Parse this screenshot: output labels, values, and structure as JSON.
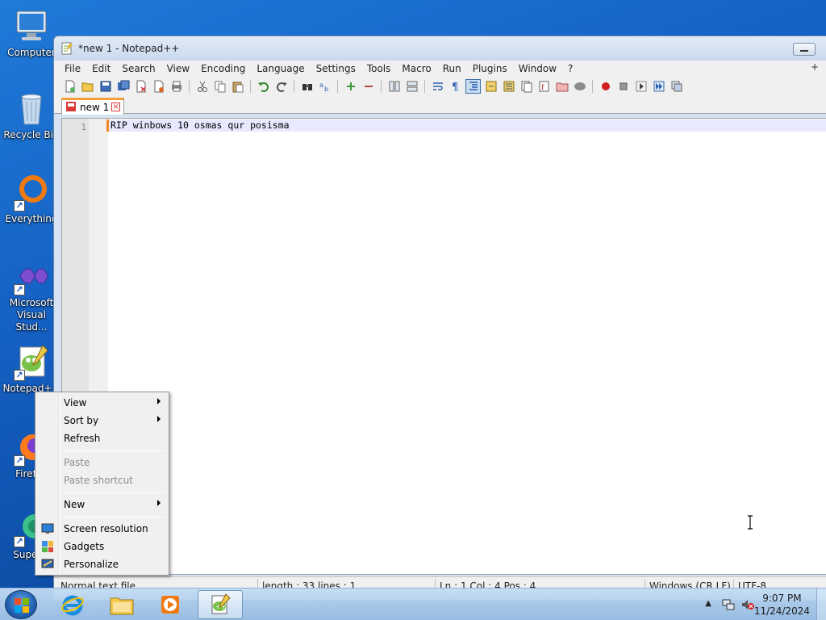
{
  "desktop": {
    "icons": [
      {
        "label": "Computer",
        "icon": "computer-icon"
      },
      {
        "label": "Recycle Bin",
        "icon": "recycle-bin-icon"
      },
      {
        "label": "Everything",
        "icon": "everything-icon"
      },
      {
        "label": "Microsoft Visual Stud...",
        "icon": "visual-studio-icon"
      },
      {
        "label": "Notepad++",
        "icon": "notepad-plus-plus-icon"
      },
      {
        "label": "Firefox",
        "icon": "firefox-icon"
      },
      {
        "label": "Super...",
        "icon": "super-app-icon"
      }
    ]
  },
  "window": {
    "title": "*new 1 - Notepad++",
    "menu": [
      "File",
      "Edit",
      "Search",
      "View",
      "Encoding",
      "Language",
      "Settings",
      "Tools",
      "Macro",
      "Run",
      "Plugins",
      "Window",
      "?"
    ],
    "menu_extra": "+",
    "tab": {
      "label": "new 1",
      "close": "×"
    },
    "editor": {
      "line_number": "1",
      "line_text": "RIP winbows 10 osmas qur posisma"
    },
    "status": {
      "type": "Normal text file",
      "length": "length : 33    lines : 1",
      "position": "Ln : 1    Col : 4    Pos : 4",
      "eol": "Windows (CR LF)",
      "encoding": "UTF-8"
    }
  },
  "context_menu": {
    "items": [
      {
        "label": "View",
        "submenu": true,
        "disabled": false
      },
      {
        "label": "Sort by",
        "submenu": true,
        "disabled": false
      },
      {
        "label": "Refresh",
        "submenu": false,
        "disabled": false
      },
      {
        "label": "Paste",
        "submenu": false,
        "disabled": true
      },
      {
        "label": "Paste shortcut",
        "submenu": false,
        "disabled": true
      },
      {
        "label": "New",
        "submenu": true,
        "disabled": false
      },
      {
        "label": "Screen resolution",
        "submenu": false,
        "disabled": false,
        "icon": "screen-resolution-icon"
      },
      {
        "label": "Gadgets",
        "submenu": false,
        "disabled": false,
        "icon": "gadgets-icon"
      },
      {
        "label": "Personalize",
        "submenu": false,
        "disabled": false,
        "icon": "personalize-icon"
      }
    ]
  },
  "taskbar": {
    "apps": [
      "internet-explorer-icon",
      "file-explorer-icon",
      "media-player-icon",
      "notepad-plus-plus-icon"
    ],
    "clock": {
      "time": "9:07 PM",
      "date": "11/24/2024"
    }
  },
  "colors": {
    "desktop_top": "#1f7ad8",
    "desktop_bottom": "#0a4190",
    "tab_accent": "#f4a037",
    "current_line": "#e8e8ff",
    "caret_marker": "#f08a24"
  }
}
